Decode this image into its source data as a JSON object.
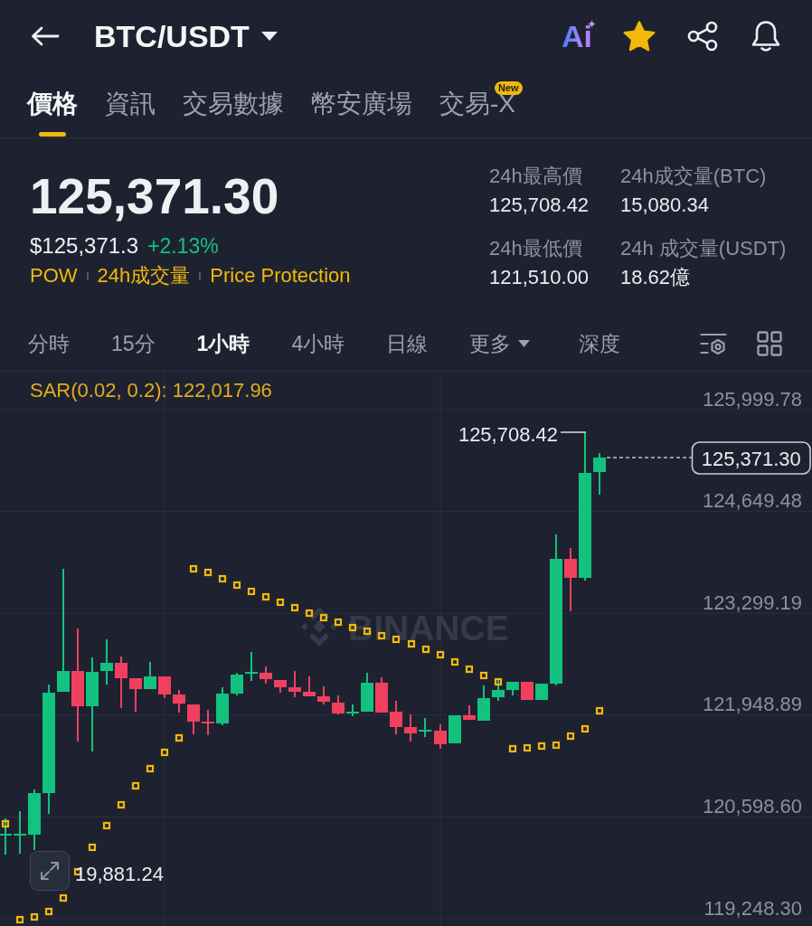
{
  "header": {
    "title": "BTC/USDT",
    "ai_label": "Ai",
    "favorited": true
  },
  "tabs": [
    {
      "label": "價格",
      "selected": true
    },
    {
      "label": "資訊",
      "selected": false
    },
    {
      "label": "交易數據",
      "selected": false
    },
    {
      "label": "幣安廣場",
      "selected": false
    },
    {
      "label": "交易-X",
      "selected": false,
      "badge": "New"
    }
  ],
  "quote": {
    "last_price": "125,371.30",
    "usd_price": "$125,371.3",
    "change": "+2.13%",
    "tags": [
      "POW",
      "24h成交量",
      "Price Protection"
    ],
    "stats": [
      {
        "label": "24h最高價",
        "value": "125,708.42"
      },
      {
        "label": "24h成交量(BTC)",
        "value": "15,080.34"
      },
      {
        "label": "24h最低價",
        "value": "121,510.00"
      },
      {
        "label": "24h 成交量(USDT)",
        "value": "18.62億"
      }
    ]
  },
  "intervals": [
    {
      "label": "分時",
      "kind": "tab",
      "selected": false
    },
    {
      "label": "15分",
      "kind": "tab",
      "selected": false
    },
    {
      "label": "1小時",
      "kind": "tab",
      "selected": true
    },
    {
      "label": "4小時",
      "kind": "tab",
      "selected": false
    },
    {
      "label": "日線",
      "kind": "tab",
      "selected": false
    },
    {
      "label": "更多",
      "kind": "dropdown",
      "selected": false
    },
    {
      "label": "深度",
      "kind": "tab",
      "selected": false
    }
  ],
  "chart": {
    "indicator": "SAR(0.02, 0.2): 122,017.96",
    "watermark": "BINANCE",
    "y_labels": [
      "125,999.78",
      "124,649.48",
      "123,299.19",
      "121,948.89",
      "120,598.60",
      "119,248.30"
    ],
    "high_label": "125,708.42",
    "last_price_tag": "125,371.30",
    "low_label": "19,881.24"
  }
}
